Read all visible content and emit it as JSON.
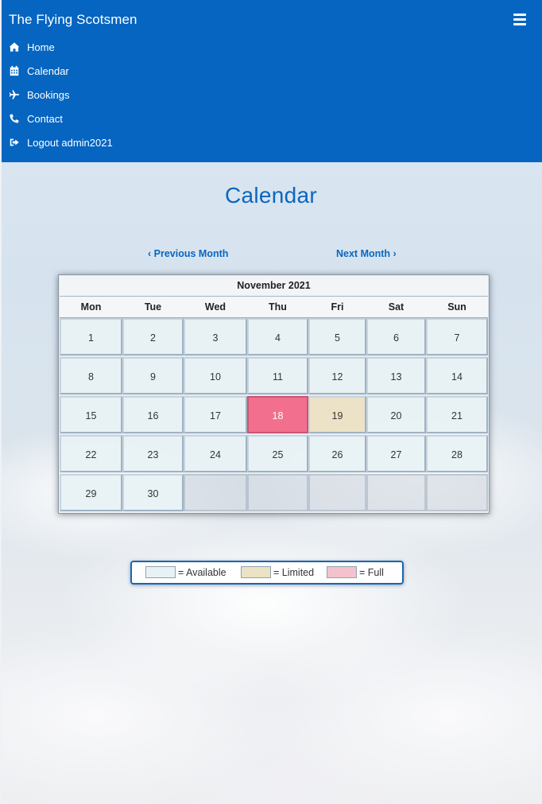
{
  "navbar": {
    "brand": "The Flying Scotsmen",
    "menu_icon": "hamburger-menu-icon",
    "items": [
      {
        "label": "Home",
        "icon": "home-icon"
      },
      {
        "label": "Calendar",
        "icon": "calendar-icon"
      },
      {
        "label": "Bookings",
        "icon": "plane-icon"
      },
      {
        "label": "Contact",
        "icon": "phone-icon"
      },
      {
        "label": "Logout admin2021",
        "icon": "sign-out-icon"
      }
    ]
  },
  "page": {
    "title": "Calendar",
    "prev_month": "Previous Month",
    "next_month": "Next Month"
  },
  "calendar": {
    "month_title": "November 2021",
    "weekdays": [
      "Mon",
      "Tue",
      "Wed",
      "Thu",
      "Fri",
      "Sat",
      "Sun"
    ],
    "weeks": [
      [
        "1",
        "2",
        "3",
        "4",
        "5",
        "6",
        "7"
      ],
      [
        "8",
        "9",
        "10",
        "11",
        "12",
        "13",
        "14"
      ],
      [
        "15",
        "16",
        "17",
        "18",
        "19",
        "20",
        "21"
      ],
      [
        "22",
        "23",
        "24",
        "25",
        "26",
        "27",
        "28"
      ],
      [
        "29",
        "30",
        "",
        "",
        "",
        "",
        ""
      ]
    ],
    "statuses": [
      [
        "available",
        "available",
        "available",
        "available",
        "available",
        "available",
        "available"
      ],
      [
        "available",
        "available",
        "available",
        "available",
        "available",
        "available",
        "available"
      ],
      [
        "available",
        "available",
        "available",
        "full",
        "limited",
        "available",
        "available"
      ],
      [
        "available",
        "available",
        "available",
        "available",
        "available",
        "available",
        "available"
      ],
      [
        "available",
        "available",
        "empty",
        "empty",
        "empty",
        "empty",
        "empty"
      ]
    ],
    "colors": {
      "available": "#e8f2f4",
      "limited": "#ece2c4",
      "full": "#f2708e"
    }
  },
  "legend": {
    "available": "= Available",
    "limited": "= Limited",
    "full": "= Full"
  },
  "colors": {
    "navbar": "#0565c1",
    "accent": "#0a67bf"
  }
}
